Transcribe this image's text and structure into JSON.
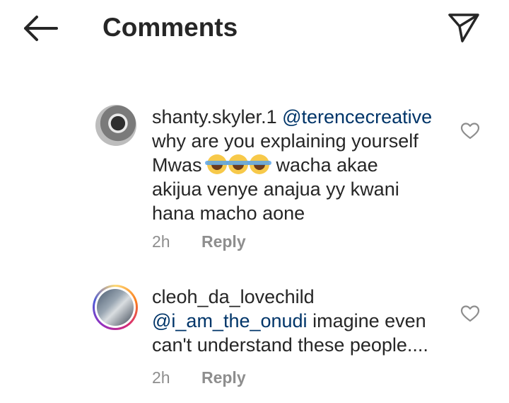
{
  "header": {
    "title": "Comments",
    "back_icon": "arrow-left-icon",
    "send_icon": "paper-plane-icon"
  },
  "comments": [
    {
      "username": "shanty.skyler.1",
      "mention": "@terencecreative",
      "text_line1": "why are you explaining yourself",
      "text_line2_a": "Mwas",
      "emojis": [
        "face-with-tears-of-joy",
        "face-with-tears-of-joy",
        "face-with-tears-of-joy"
      ],
      "text_line2_b": "wacha akae",
      "text_line3": "akijua venye anajua yy kwani",
      "text_line4": "hana macho aone",
      "time": "2h",
      "reply_label": "Reply"
    },
    {
      "username": "cleoh_da_lovechild",
      "mention": "@i_am_the_onudi",
      "text_line1_rest": "imagine even",
      "text_line2": "can't understand these people....",
      "time": "2h",
      "reply_label": "Reply"
    }
  ],
  "colors": {
    "text": "#262626",
    "mention": "#003569",
    "meta": "#8e8e8e"
  }
}
